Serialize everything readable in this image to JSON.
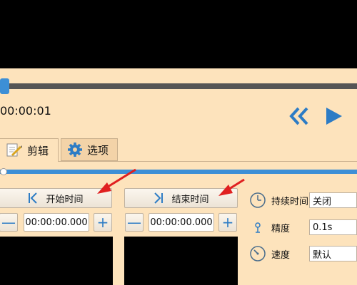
{
  "player": {
    "timecode": "00:00:01",
    "rewind_icon": "double-chevron-left-icon",
    "play_icon": "play-icon"
  },
  "tabs": [
    {
      "label": "剪辑",
      "icon": "edit-icon"
    },
    {
      "label": "选项",
      "icon": "gear-icon"
    }
  ],
  "trim": {
    "start_label": "开始时间",
    "end_label": "结束时间",
    "start_time": "00:00:00.000",
    "end_time": "00:00:00.000",
    "minus": "—",
    "plus": "+"
  },
  "settings": {
    "duration_label": "持续时间",
    "duration_value": "关闭",
    "precision_label": "精度",
    "precision_value": "0.1s",
    "speed_label": "速度",
    "speed_value": "默认"
  },
  "colors": {
    "panel": "#fde3bc",
    "accent": "#3d8fd6",
    "annotation": "#e02020"
  }
}
